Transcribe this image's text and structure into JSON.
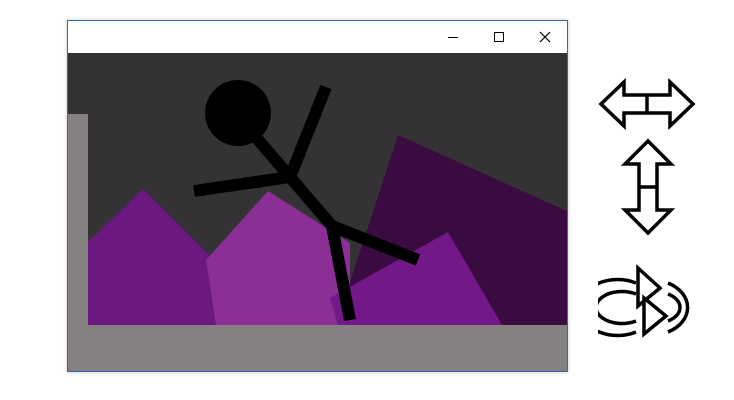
{
  "window": {
    "title": "",
    "controls": {
      "minimize": "minimize-icon",
      "maximize": "maximize-icon",
      "close": "close-icon"
    }
  },
  "scene": {
    "colors": {
      "sky": "#353236",
      "ground": "#858180",
      "wall": "#858180",
      "mountain_far": "#3a0b40",
      "mountain_left": "#6b1880",
      "mountain_mid": "#8b2f96",
      "mountain_right": "#721888",
      "stickman": "#000000"
    }
  },
  "tools": [
    {
      "icon": "move-horizontal-icon"
    },
    {
      "icon": "move-vertical-icon"
    },
    {
      "icon": "rotate-icon"
    }
  ]
}
